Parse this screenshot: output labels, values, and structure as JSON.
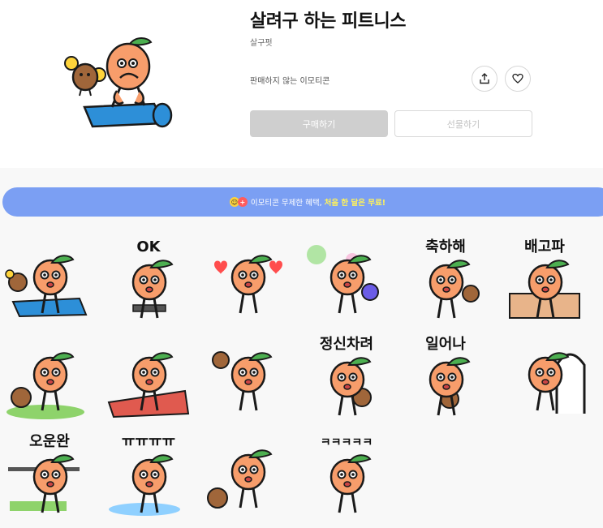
{
  "product": {
    "title": "살려구 하는 피트니스",
    "author": "살구펏",
    "notice": "판매하지 않는 이모티콘",
    "buy_label": "구매하기",
    "gift_label": "선물하기",
    "share_icon": "share-icon",
    "like_icon": "heart-icon"
  },
  "banner": {
    "text": "이모티콘 무제한 혜택,",
    "highlight": "처음 한 달은 무료!"
  },
  "stickers": [
    {
      "caption": ""
    },
    {
      "caption": "OK"
    },
    {
      "caption": ""
    },
    {
      "caption": ""
    },
    {
      "caption": "축하해"
    },
    {
      "caption": "배고파"
    },
    {
      "caption": ""
    },
    {
      "caption": ""
    },
    {
      "caption": ""
    },
    {
      "caption": "정신차려"
    },
    {
      "caption": "일어나"
    },
    {
      "caption": ""
    },
    {
      "caption": "오운완"
    },
    {
      "caption": "ㅠㅠㅠㅠ"
    },
    {
      "caption": ""
    },
    {
      "caption": "ㅋㅋㅋㅋㅋ"
    }
  ],
  "colors": {
    "apricot": "#f79d6b",
    "outline": "#1a1a1a",
    "leaf": "#4caf50",
    "banner": "#7b9ff3",
    "highlight": "#fff35a",
    "buy_disabled": "#cfcfcf"
  }
}
